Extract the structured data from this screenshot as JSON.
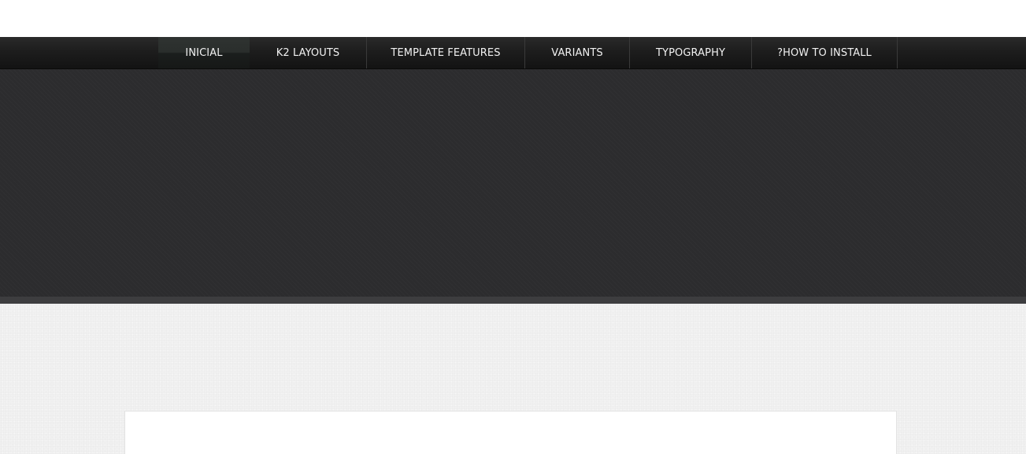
{
  "nav": {
    "items": [
      {
        "label": "INICIAL",
        "active": true
      },
      {
        "label": "K2 LAYOUTS",
        "active": false
      },
      {
        "label": "TEMPLATE FEATURES",
        "active": false
      },
      {
        "label": "VARIANTS",
        "active": false
      },
      {
        "label": "TYPOGRAPHY",
        "active": false
      },
      {
        "label": "?HOW TO INSTALL",
        "active": false
      }
    ]
  },
  "colors": {
    "navbar": "#1d1d1d",
    "hero": "#2c2c2e",
    "hero_bottom_bar": "#3d3d3f",
    "content_background": "#f1f1f1",
    "content_box": "#ffffff",
    "nav_text": "#f1f1f1"
  }
}
